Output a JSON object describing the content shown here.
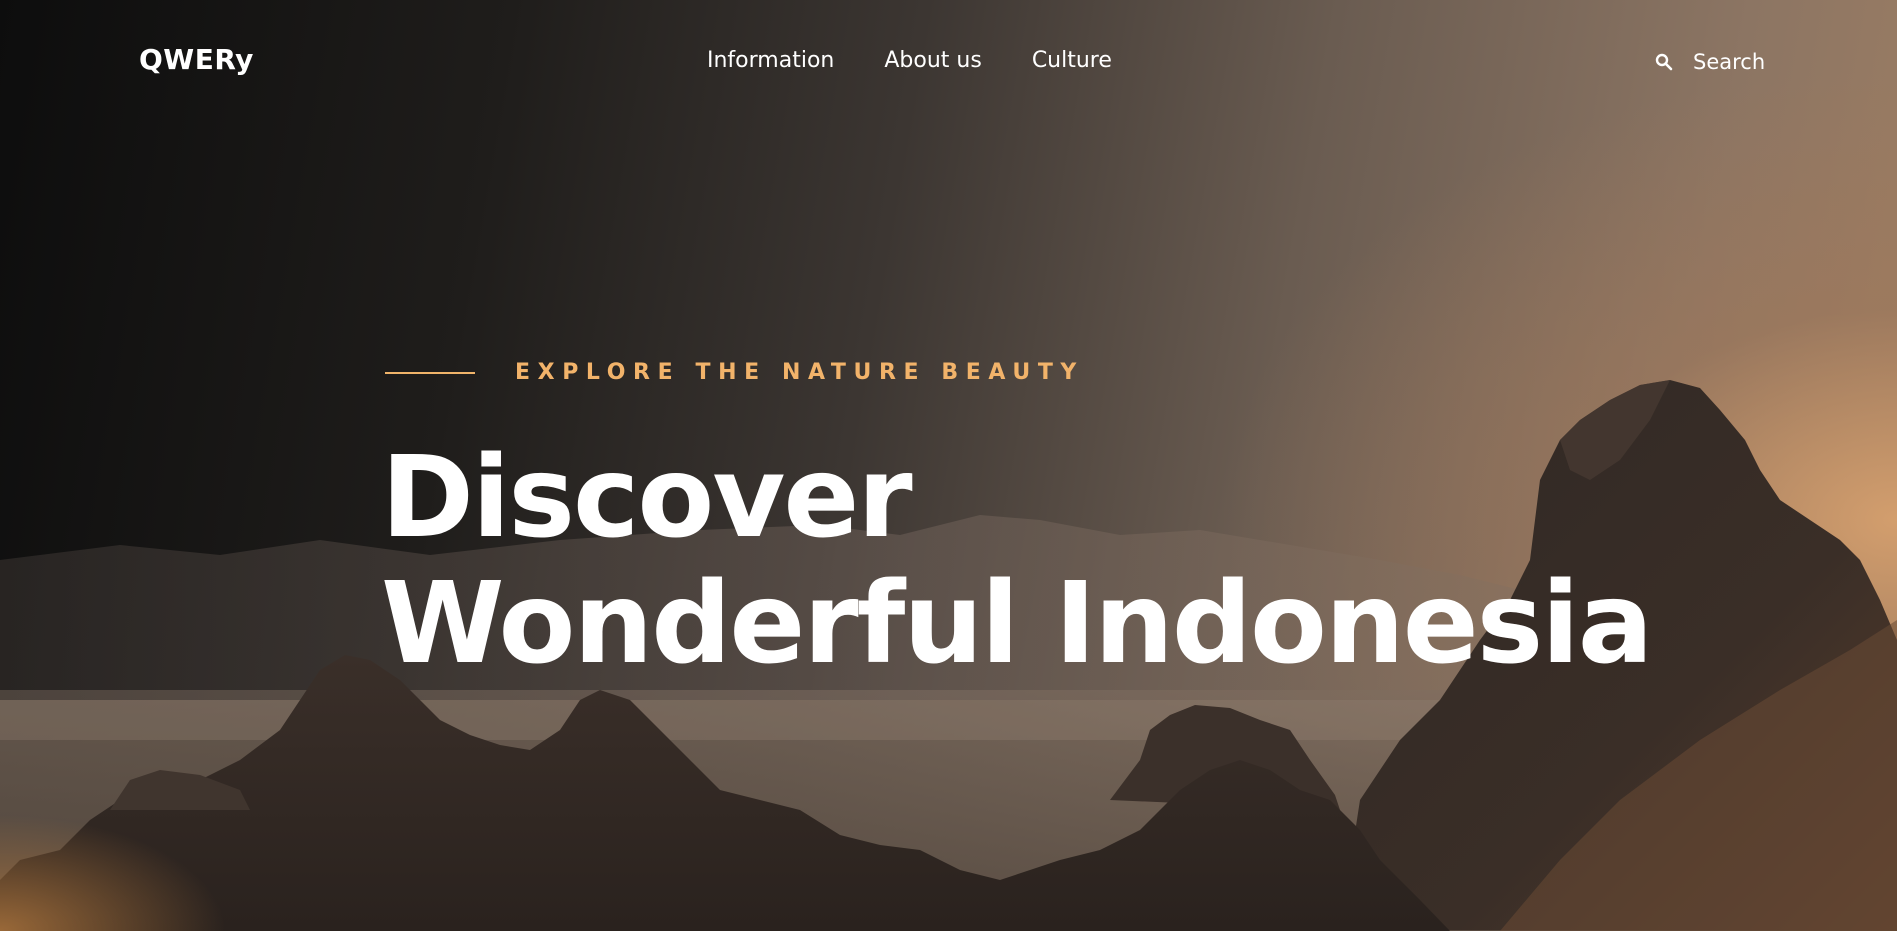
{
  "brand": {
    "logo_text": "QWERy"
  },
  "nav": {
    "links": [
      {
        "label": "Information"
      },
      {
        "label": "About us"
      },
      {
        "label": "Culture"
      }
    ],
    "search": {
      "label": "Search",
      "icon": "search-icon"
    }
  },
  "hero": {
    "eyebrow": "EXPLORE THE NATURE BEAUTY",
    "headline_line1": "Discover",
    "headline_line2": "Wonderful Indonesia",
    "background": "mountain landscape at dusk",
    "colors": {
      "accent": "#f2b36a",
      "text": "#ffffff"
    }
  }
}
